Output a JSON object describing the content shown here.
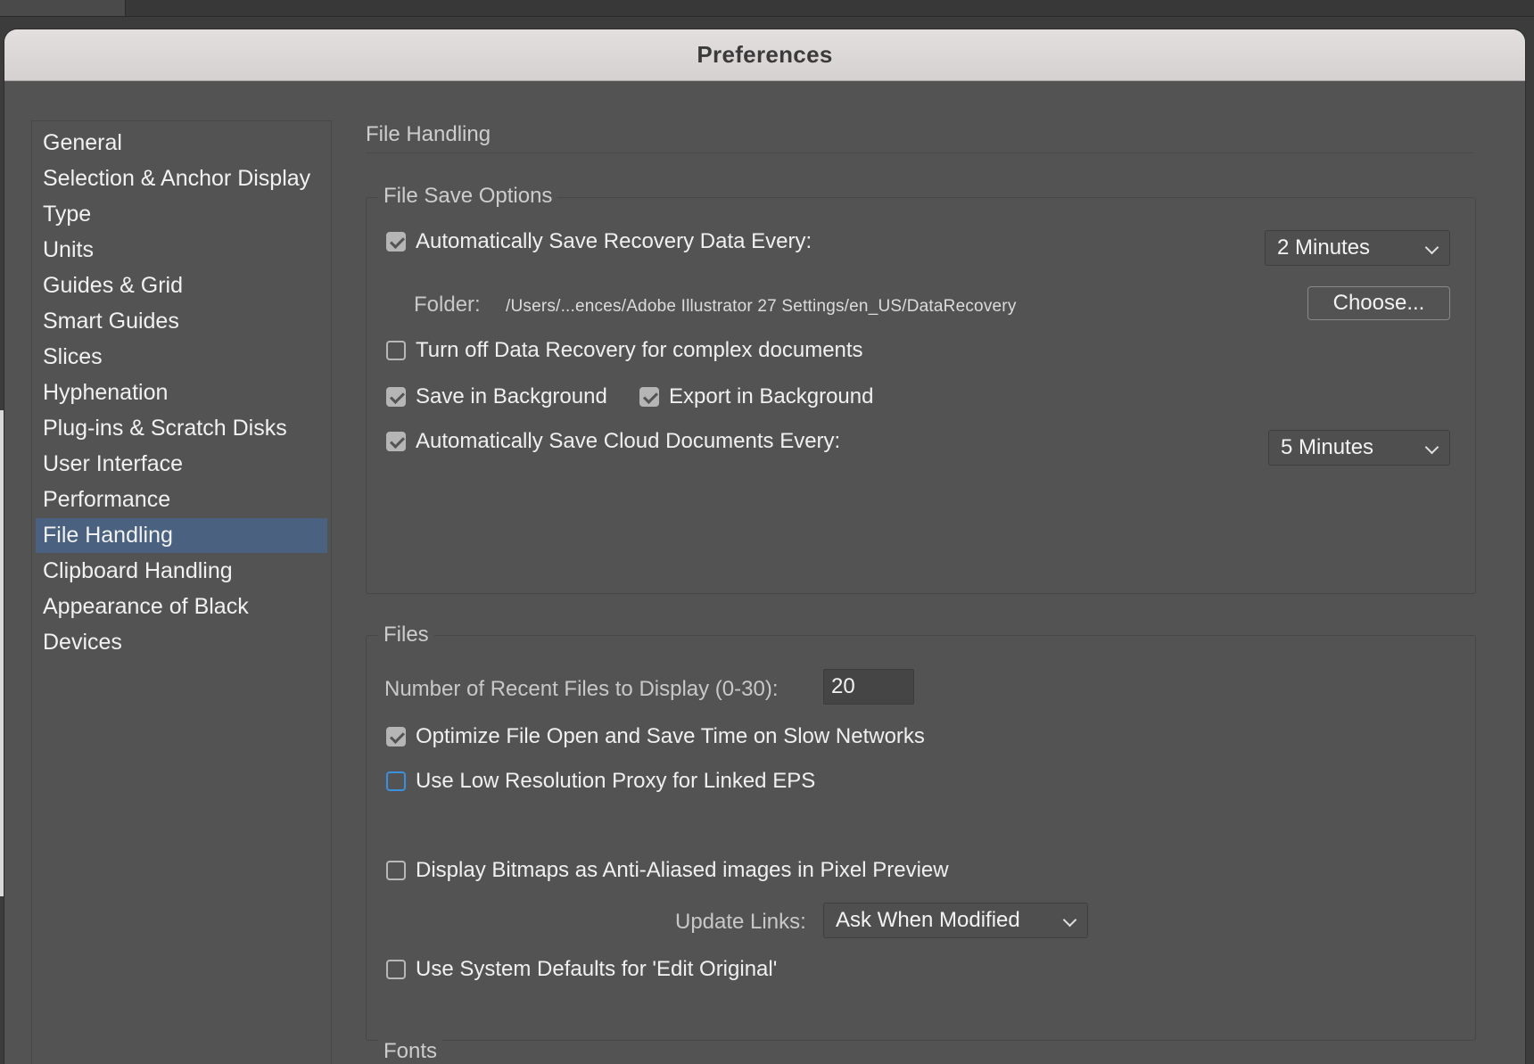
{
  "dialog": {
    "title": "Preferences"
  },
  "sidebar": {
    "items": [
      {
        "label": "General"
      },
      {
        "label": "Selection & Anchor Display"
      },
      {
        "label": "Type"
      },
      {
        "label": "Units"
      },
      {
        "label": "Guides & Grid"
      },
      {
        "label": "Smart Guides"
      },
      {
        "label": "Slices"
      },
      {
        "label": "Hyphenation"
      },
      {
        "label": "Plug-ins & Scratch Disks"
      },
      {
        "label": "User Interface"
      },
      {
        "label": "Performance"
      },
      {
        "label": "File Handling",
        "selected": true
      },
      {
        "label": "Clipboard Handling"
      },
      {
        "label": "Appearance of Black"
      },
      {
        "label": "Devices"
      }
    ]
  },
  "main": {
    "section_title": "File Handling",
    "file_save_options": {
      "label": "File Save Options",
      "auto_save_recovery": {
        "label": "Automatically Save Recovery Data Every:",
        "checked": true
      },
      "recovery_interval": {
        "value": "2 Minutes"
      },
      "folder_label": "Folder:",
      "folder_path": "/Users/...ences/Adobe Illustrator 27 Settings/en_US/DataRecovery",
      "choose_button": "Choose...",
      "turn_off_recovery": {
        "label": "Turn off Data Recovery for complex documents",
        "checked": false
      },
      "save_in_background": {
        "label": "Save in Background",
        "checked": true
      },
      "export_in_background": {
        "label": "Export in Background",
        "checked": true
      },
      "auto_save_cloud": {
        "label": "Automatically Save Cloud Documents Every:",
        "checked": true
      },
      "cloud_interval": {
        "value": "5 Minutes"
      }
    },
    "files": {
      "label": "Files",
      "recent_files_label": "Number of Recent Files to Display (0-30):",
      "recent_files_value": "20",
      "optimize_slow_networks": {
        "label": "Optimize File Open and Save Time on Slow Networks",
        "checked": true
      },
      "low_res_proxy": {
        "label": "Use Low Resolution Proxy for Linked EPS",
        "checked": false
      },
      "anti_aliased_bitmaps": {
        "label": "Display Bitmaps as Anti-Aliased images in Pixel Preview",
        "checked": false
      },
      "update_links_label": "Update Links:",
      "update_links_value": "Ask When Modified",
      "system_defaults_edit_original": {
        "label": "Use System Defaults for 'Edit Original'",
        "checked": false
      }
    },
    "next_section_label": "Fonts"
  },
  "colors": {
    "dialog_bg": "#535353",
    "selected_item": "#4a6280",
    "focus_ring": "#3d8fe0",
    "titlebar": "#dcd8d8"
  },
  "icons": {
    "checkbox_checked": "checkmark",
    "dropdown": "chevron-down"
  }
}
